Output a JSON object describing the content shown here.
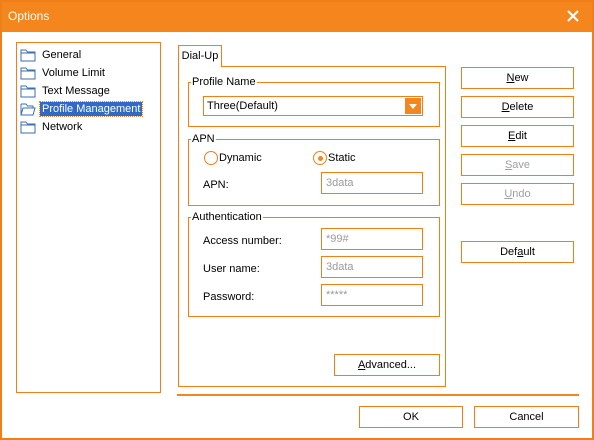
{
  "window": {
    "title": "Options"
  },
  "tree": {
    "items": [
      {
        "label": "General",
        "selected": false
      },
      {
        "label": "Volume Limit",
        "selected": false
      },
      {
        "label": "Text Message",
        "selected": false
      },
      {
        "label": "Profile Management",
        "selected": true
      },
      {
        "label": "Network",
        "selected": false
      }
    ]
  },
  "tab": {
    "label": "Dial-Up"
  },
  "profile": {
    "group_label": "Profile Name",
    "selected_value": "Three(Default)"
  },
  "apn": {
    "group_label": "APN",
    "dynamic_label": "Dynamic",
    "static_label": "Static",
    "selected_mode": "Static",
    "apn_label": "APN:",
    "apn_value": "3data"
  },
  "auth": {
    "group_label": "Authentication",
    "access_label": "Access number:",
    "access_value": "*99#",
    "user_label": "User name:",
    "user_value": "3data",
    "password_label": "Password:",
    "password_value": "*****"
  },
  "buttons": {
    "advanced": {
      "pre": "",
      "u": "A",
      "post": "dvanced..."
    },
    "new": {
      "pre": "",
      "u": "N",
      "post": "ew"
    },
    "delete": {
      "pre": "",
      "u": "D",
      "post": "elete"
    },
    "edit": {
      "pre": "",
      "u": "E",
      "post": "dit"
    },
    "save": {
      "pre": "",
      "u": "S",
      "post": "ave"
    },
    "undo": {
      "pre": "",
      "u": "U",
      "post": "ndo"
    },
    "default": {
      "pre": "Def",
      "u": "a",
      "post": "ult"
    },
    "ok": "OK",
    "cancel": "Cancel"
  },
  "colors": {
    "accent": "#f4861d",
    "selection": "#316ac5",
    "disabled_text": "#a0a0a0"
  }
}
